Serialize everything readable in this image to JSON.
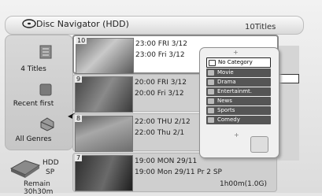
{
  "header": {
    "title": "Disc Navigator (HDD)",
    "titles_count": "10Titles"
  },
  "left_panel": {
    "items": [
      {
        "label": "4 Titles",
        "icon": "titles-list-icon"
      },
      {
        "label": "Recent first",
        "icon": "sort-icon"
      },
      {
        "label": "All Genres",
        "icon": "genre-icon"
      }
    ]
  },
  "recordings": [
    {
      "num": "10",
      "line1": "23:00  FRI   3/12",
      "line2": "23:00   Fri   3/12"
    },
    {
      "num": "9",
      "line1": "20:00   FRI   3/12",
      "line2": "20:00   Fri   3/12"
    },
    {
      "num": "8",
      "line1": "22:00   THU   2/12",
      "line2": "22:00   Thu   2/1"
    },
    {
      "num": "7",
      "line1": "19:00   MON   29/11",
      "line2": "19:00   Mon   29/11   Pr 2   SP"
    }
  ],
  "duration": "1h00m(1.0G)",
  "remain": {
    "hdd": "HDD",
    "mode": "SP",
    "label": "Remain",
    "value": "30h30m"
  },
  "genre_menu": {
    "items": [
      {
        "label": "No Category",
        "active": true
      },
      {
        "label": "Movie",
        "active": false
      },
      {
        "label": "Drama",
        "active": false
      },
      {
        "label": "Entertainmt.",
        "active": false
      },
      {
        "label": "News",
        "active": false
      },
      {
        "label": "Sports",
        "active": false
      },
      {
        "label": "Comedy",
        "active": false
      }
    ]
  },
  "colors": {
    "background": "#e6e6e6",
    "menu_item": "#555555",
    "selected_row": "#ffffff"
  }
}
